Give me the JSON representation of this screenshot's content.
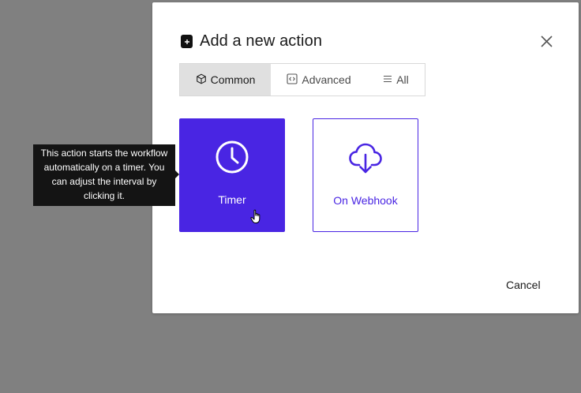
{
  "dialog": {
    "title": "Add a new action",
    "title_icon": "plus-square-icon",
    "close_icon": "close-icon"
  },
  "tabs": [
    {
      "label": "Common",
      "icon": "cube-icon",
      "active": true
    },
    {
      "label": "Advanced",
      "icon": "code-icon",
      "active": false
    },
    {
      "label": "All",
      "icon": "list-icon",
      "active": false
    }
  ],
  "actions": [
    {
      "label": "Timer",
      "icon": "clock-icon",
      "selected": true
    },
    {
      "label": "On Webhook",
      "icon": "cloud-download-icon",
      "selected": false
    }
  ],
  "tooltip": {
    "text": "This action starts the workflow automatically on a timer. You can adjust the interval by clicking it."
  },
  "footer": {
    "cancel_label": "Cancel"
  },
  "colors": {
    "accent": "#4925e3",
    "backdrop": "#808080",
    "tooltip_bg": "#141414",
    "tab_active_bg": "#e0e0e0"
  }
}
